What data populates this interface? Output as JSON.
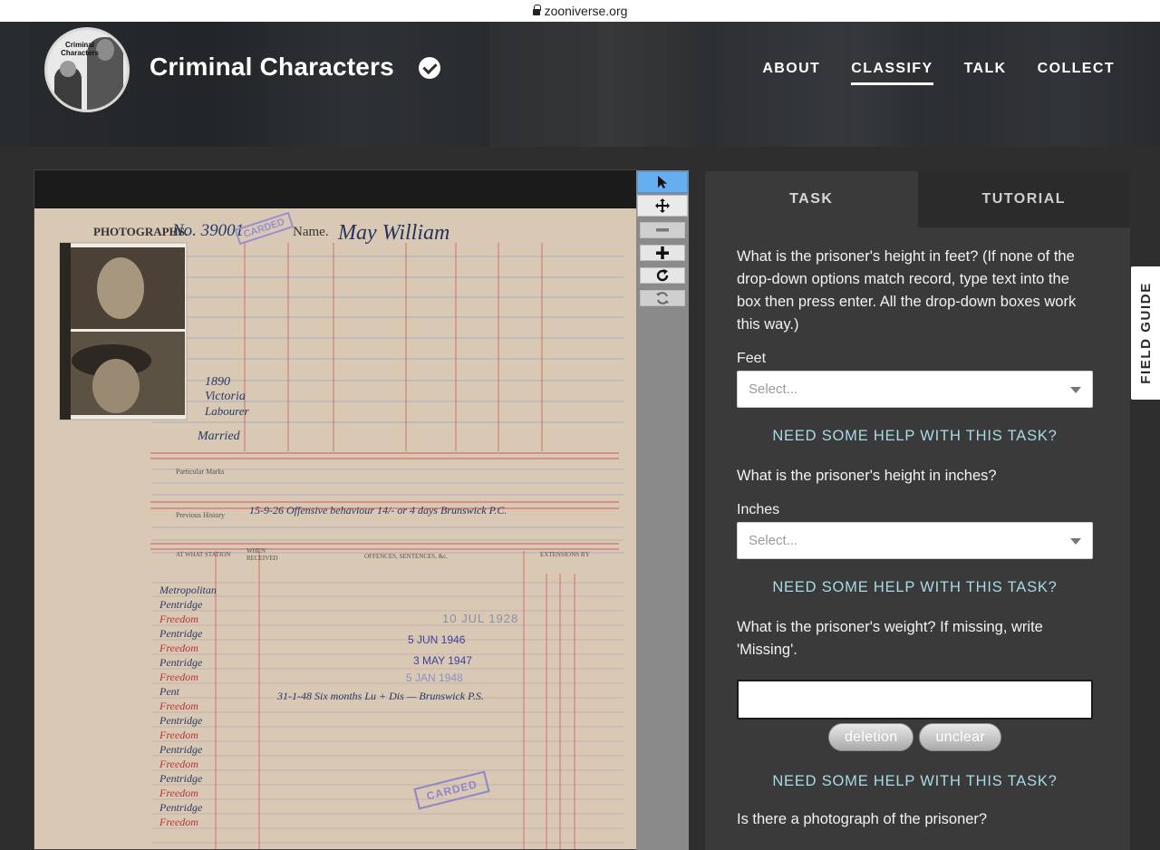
{
  "browser": {
    "url": "zooniverse.org"
  },
  "project": {
    "avatar_text": "Criminal Characters",
    "title": "Criminal Characters",
    "nav": [
      {
        "label": "ABOUT",
        "active": false
      },
      {
        "label": "CLASSIFY",
        "active": true
      },
      {
        "label": "TALK",
        "active": false
      },
      {
        "label": "COLLECT",
        "active": false
      }
    ]
  },
  "viewer": {
    "tools": [
      "pointer-icon",
      "move-icon",
      "zoom-out-icon",
      "zoom-in-icon",
      "rotate-icon",
      "reset-icon"
    ],
    "document": {
      "photographs_label": "PHOTOGRAPHS.",
      "number": "No. 39001",
      "name_label": "Name.",
      "name": "May William",
      "stamp_top": "CARDED",
      "stamp_bottom": "CARDED",
      "year": "1890",
      "place": "Victoria",
      "occupation": "Labourer",
      "status": "Married",
      "particular_marks": "Particular Marks",
      "previous_history": "Previous History",
      "history_text": "15-9-26 Offensive behaviour 14/- or 4 days Brunswick P.C.",
      "col_station": "AT WHAT STATION",
      "col_when": "WHEN RECEIVED",
      "col_offences": "OFFENCES, SENTENCES, &c.",
      "col_extensions": "EXTENSIONS BY",
      "stamp_1": "10 JUL 1928",
      "stamp_2": "5 JUN 1946",
      "stamp_3": "3 MAY 1947",
      "stamp_4": "5 JAN 1948",
      "entry_line": "31-1-48 Six months Lu + Dis — Brunswick P.S.",
      "stations": [
        "Metropolitan",
        "Pentridge",
        "Freedom",
        "Pentridge",
        "Freedom",
        "Pentridge",
        "Freedom",
        "Pent",
        "Freedom",
        "Pentridge",
        "Freedom",
        "Pentridge",
        "Freedom",
        "Pentridge",
        "Freedom",
        "Pentridge",
        "Freedom"
      ]
    }
  },
  "panel": {
    "tabs": [
      {
        "label": "TASK",
        "active": true
      },
      {
        "label": "TUTORIAL",
        "active": false
      }
    ],
    "q_feet": "What is the prisoner's height in feet? (If none of the drop-down options match record, type text into the box then press enter. All the drop-down boxes work this way.)",
    "feet_label": "Feet",
    "feet_placeholder": "Select...",
    "help_1": "NEED SOME HELP WITH THIS TASK?",
    "q_inches": "What is the prisoner's height in inches?",
    "inches_label": "Inches",
    "inches_placeholder": "Select...",
    "help_2": "NEED SOME HELP WITH THIS TASK?",
    "q_weight": "What is the prisoner's weight? If missing, write 'Missing'.",
    "weight_value": "",
    "pill_deletion": "deletion",
    "pill_unclear": "unclear",
    "help_3": "NEED SOME HELP WITH THIS TASK?",
    "q_photo": "Is there a photograph of the prisoner?"
  },
  "field_guide": {
    "label": "FIELD GUIDE"
  },
  "colors": {
    "accent_blue": "#65aef0",
    "help_link": "#a8dbe6",
    "panel_bg": "#3a3a3a",
    "page_bg": "#2e2e2e"
  }
}
